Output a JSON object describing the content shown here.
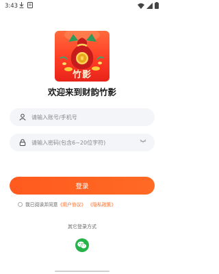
{
  "status_bar": {
    "time": "3:43"
  },
  "app": {
    "logo_text": "竹影",
    "welcome_title": "欢迎来到财韵竹影"
  },
  "form": {
    "account_placeholder": "请输入账号/手机号",
    "password_placeholder": "请输入密码(包含6~20位字符)",
    "login_label": "登录"
  },
  "agreement": {
    "prefix": "我已阅读并同意",
    "user_agreement": "《用户协议》",
    "privacy_policy": "《隐私政策》"
  },
  "other_login": {
    "label": "其它登录方式"
  },
  "colors": {
    "accent": "#ff6a24",
    "wechat": "#26b34a"
  },
  "icons": [
    "download-icon",
    "notification-icon",
    "wifi-icon",
    "signal-icon",
    "battery-icon",
    "user-icon",
    "lock-icon",
    "eye-toggle-icon",
    "wechat-icon"
  ]
}
